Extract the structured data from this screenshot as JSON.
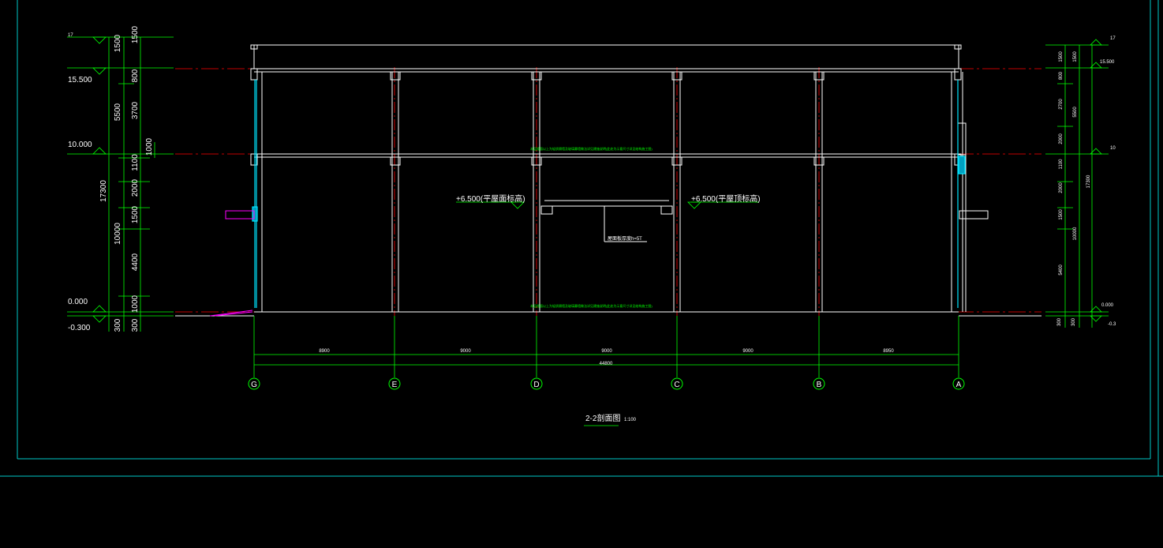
{
  "drawing": {
    "title": "2-2剖面图",
    "scale": "1:100",
    "colors": {
      "background": "#000000",
      "dimension": "#00ff00",
      "axis": "#ff0000",
      "frame": "#00c8c8",
      "glass": "#00e5ff",
      "structure": "#ffffff",
      "canopy": "#ff00ff"
    },
    "axes": [
      {
        "label": "G"
      },
      {
        "label": "E"
      },
      {
        "label": "D"
      },
      {
        "label": "C"
      },
      {
        "label": "B"
      },
      {
        "label": "A"
      }
    ],
    "bay_dims": [
      "8900",
      "9000",
      "9000",
      "9000",
      "8950"
    ],
    "total_dim": "44800",
    "left_levels": [
      "17",
      "15.500",
      "10.000",
      "0.000",
      "-0.300"
    ],
    "right_levels": [
      "17",
      "15.500",
      "10",
      "0.000",
      "-0.3"
    ],
    "left_dims_col1": [
      "1500",
      "5500",
      "17300",
      "10000",
      "300"
    ],
    "left_dims_col2": [
      "1500",
      "800",
      "3700",
      "1100",
      "2000",
      "1500",
      "4400",
      "1000",
      "300"
    ],
    "left_dims_col3": [
      "1000"
    ],
    "right_dims_col1": [
      "1500",
      "800",
      "2700",
      "2000",
      "1100",
      "2000",
      "1500",
      "5400",
      "300"
    ],
    "right_dims_col2": [
      "1500",
      "5500",
      "10000",
      "300"
    ],
    "right_dims_col3": [
      "17300"
    ],
    "annotations": {
      "left_elev": "+6.500(平屋面标高)",
      "right_elev": "+6.500(平屋顶标高)",
      "center_note": "屋面板厚度h=5T",
      "note_upper": "本层楼面以上为轻质隔墙及玻璃幕墙做法详见建施说明(此处为示意尺寸详见结构施工图)",
      "note_lower": "本层楼面以上为轻质隔墙及玻璃幕墙做法详见建施说明(此处为示意尺寸详见结构施工图)"
    }
  }
}
